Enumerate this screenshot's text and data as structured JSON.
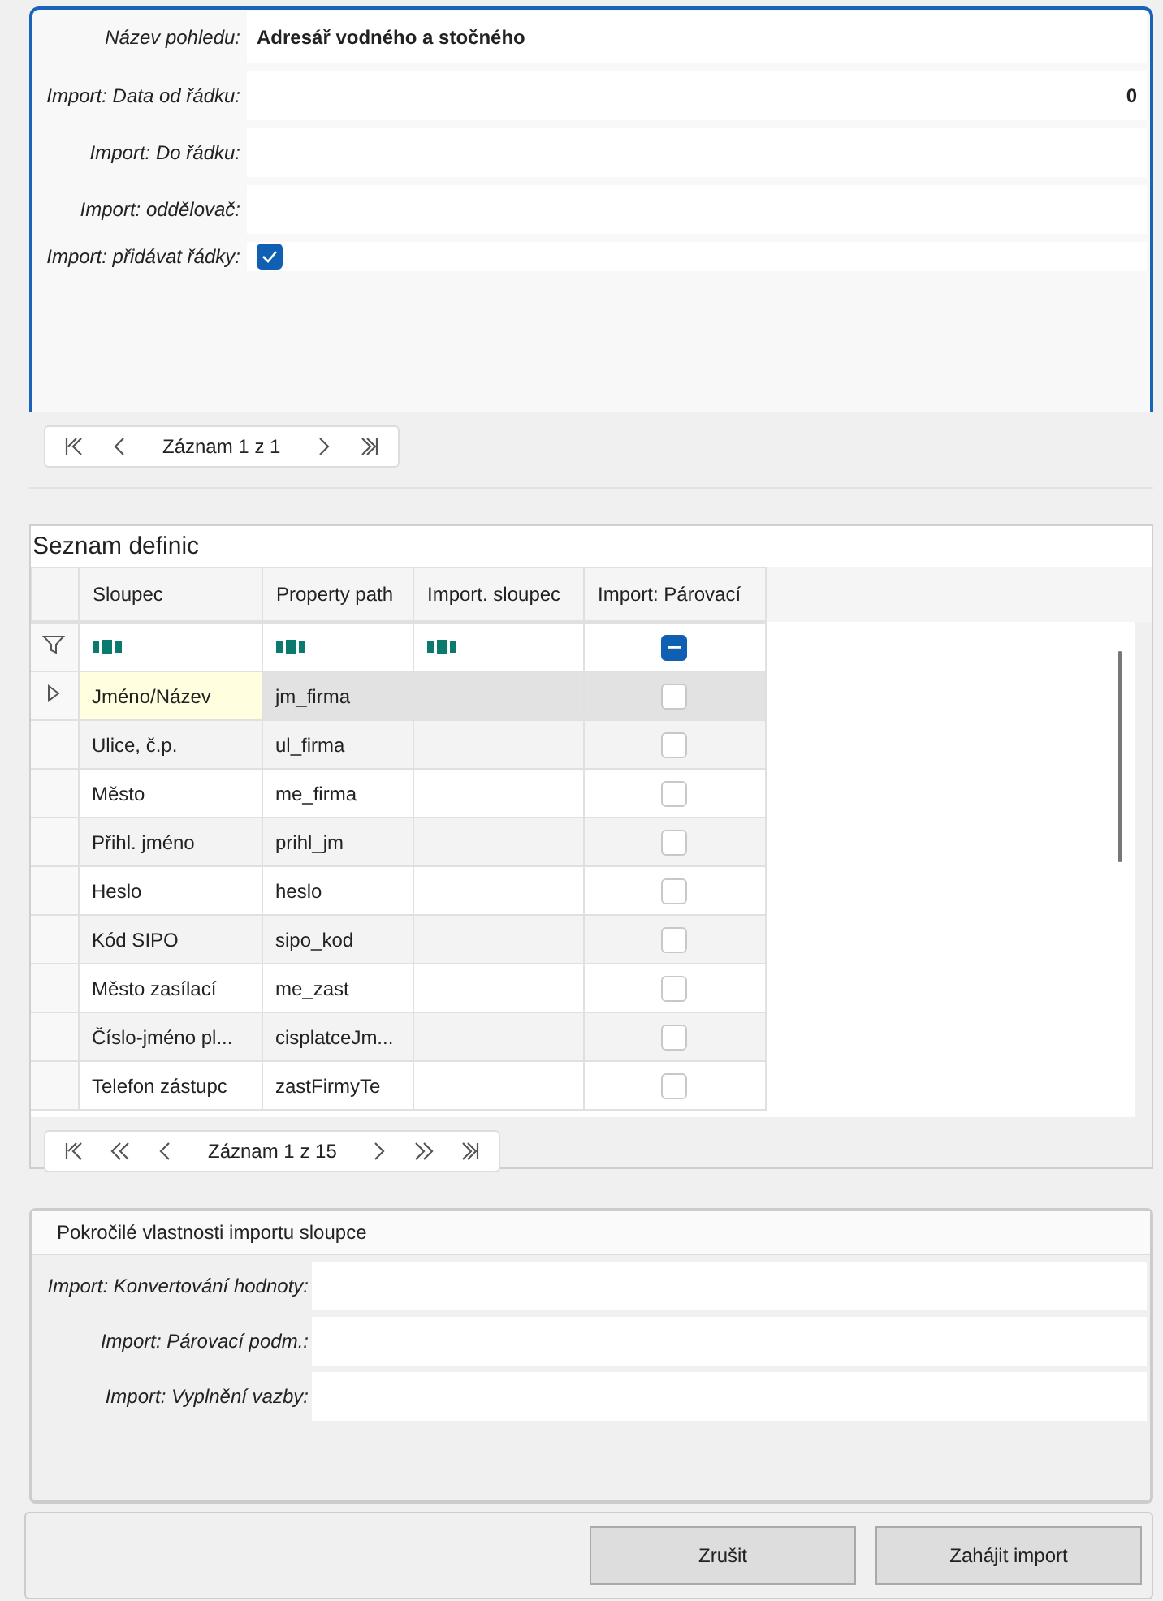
{
  "view_form": {
    "fields": [
      {
        "label": "Název pohledu:",
        "value": "Adresář vodného a stočného",
        "kind": "text"
      },
      {
        "label": "Import: Data od řádku:",
        "value": "0",
        "kind": "number"
      },
      {
        "label": "Import: Do řádku:",
        "kind": "text"
      },
      {
        "label": "Import: oddělovač:",
        "kind": "text"
      },
      {
        "label": "Import: přidávat řádky:",
        "kind": "checkbox",
        "checked": true
      }
    ],
    "pager": {
      "text": "Záznam 1 z 1",
      "buttons": [
        {
          "kind": "first"
        },
        {
          "kind": "prev"
        },
        {
          "kind": "next"
        },
        {
          "kind": "last"
        }
      ]
    }
  },
  "definitions": {
    "title": "Seznam definic",
    "columns": [
      "Sloupec",
      "Property path",
      "Import. sloupec",
      "Import: Párovací"
    ],
    "filter": {
      "matching_indeterminate": true
    },
    "rows": [
      {
        "sloupec": "Jméno/Název",
        "property_path": "jm_firma",
        "selected": true,
        "matching": false
      },
      {
        "sloupec": "Ulice, č.p.",
        "property_path": "ul_firma",
        "selected": false,
        "matching": false
      },
      {
        "sloupec": "Město",
        "property_path": "me_firma",
        "selected": false,
        "matching": false
      },
      {
        "sloupec": "Přihl. jméno",
        "property_path": "prihl_jm",
        "selected": false,
        "matching": false
      },
      {
        "sloupec": "Heslo",
        "property_path": "heslo",
        "selected": false,
        "matching": false
      },
      {
        "sloupec": "Kód SIPO",
        "property_path": "sipo_kod",
        "selected": false,
        "matching": false
      },
      {
        "sloupec": "Město zasílací",
        "property_path": "me_zast",
        "selected": false,
        "matching": false
      },
      {
        "sloupec": "Číslo-jméno pl...",
        "property_path": "cisplatceJm...",
        "selected": false,
        "matching": false
      },
      {
        "sloupec": "Telefon zástupc",
        "property_path": "zastFirmyTe",
        "selected": false,
        "matching": false
      }
    ],
    "pager": {
      "text": "Záznam 1 z 15",
      "buttons": [
        {
          "kind": "first"
        },
        {
          "kind": "prev_page"
        },
        {
          "kind": "prev"
        },
        {
          "kind": "next"
        },
        {
          "kind": "next_page"
        },
        {
          "kind": "last"
        }
      ]
    }
  },
  "advanced": {
    "title": "Pokročilé vlastnosti importu sloupce",
    "fields": [
      {
        "label": "Import: Konvertování hodnoty:"
      },
      {
        "label": "Import: Párovací podm.:"
      },
      {
        "label": "Import: Vyplnění vazby:"
      }
    ]
  },
  "buttons": [
    "Zrušit",
    "Zahájit import"
  ]
}
